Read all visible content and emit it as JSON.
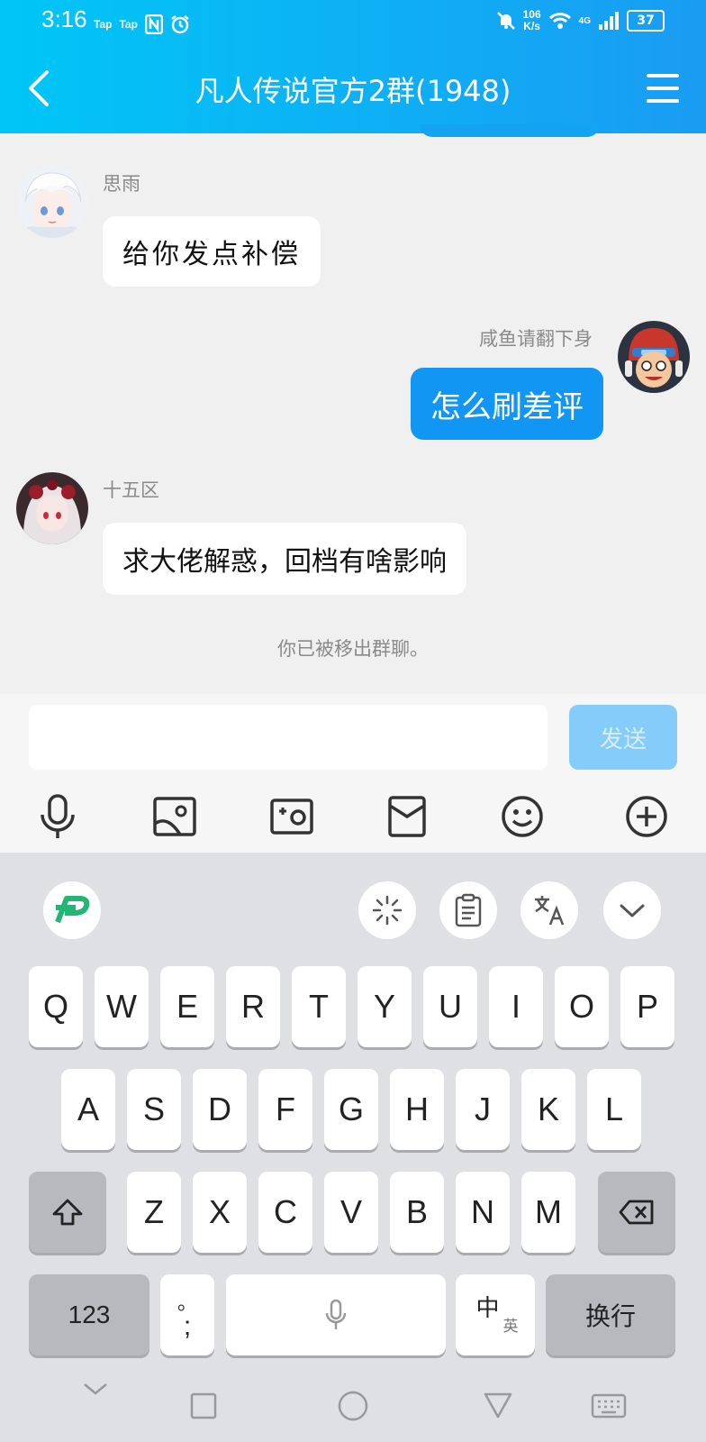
{
  "status_bar": {
    "time": "3:16",
    "tap1": "Tap",
    "tap2": "Tap",
    "speed_top": "106",
    "speed_unit": "K/s",
    "network": "4G",
    "battery": "37"
  },
  "header": {
    "title": "凡人传说官方2群(1948)"
  },
  "messages": [
    {
      "sender": "思雨",
      "text": "给你发点补偿",
      "direction": "incoming"
    },
    {
      "sender": "咸鱼请翻下身",
      "text": "怎么刷差评",
      "direction": "outgoing"
    },
    {
      "sender": "十五区",
      "text": "求大佬解惑，回档有啥影响",
      "direction": "incoming"
    }
  ],
  "system_notice": "你已被移出群聊。",
  "composer": {
    "input_value": "",
    "send_label": "发送"
  },
  "toolbar_icons": [
    "microphone-icon",
    "image-icon",
    "camera-icon",
    "red-packet-icon",
    "emoji-icon",
    "plus-icon"
  ],
  "keyboard": {
    "top_icons": [
      "logo-icon",
      "loading-icon",
      "clipboard-icon",
      "translate-icon",
      "collapse-icon"
    ],
    "row1": [
      "Q",
      "W",
      "E",
      "R",
      "T",
      "Y",
      "U",
      "I",
      "O",
      "P"
    ],
    "row2": [
      "A",
      "S",
      "D",
      "F",
      "G",
      "H",
      "J",
      "K",
      "L"
    ],
    "row3": [
      "Z",
      "X",
      "C",
      "V",
      "B",
      "N",
      "M"
    ],
    "num_label": "123",
    "punct_top": "。",
    "punct_bottom": ";",
    "lang_main": "中",
    "lang_sub": "英",
    "enter_label": "换行"
  },
  "colors": {
    "header_start": "#00c6f6",
    "header_end": "#1a9cf3",
    "outgoing_bubble": "#1296f3",
    "send_disabled": "#86ccfb"
  }
}
